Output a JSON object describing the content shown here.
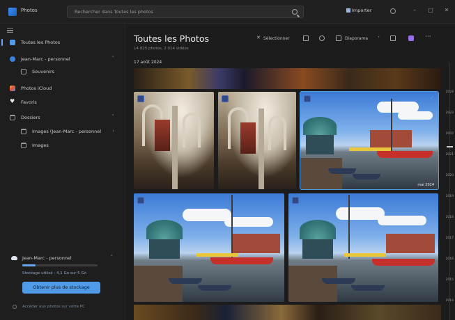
{
  "window": {
    "app_title": "Photos",
    "search_placeholder": "Rechercher dans Toutes les photos",
    "import_label": "Importer"
  },
  "sidebar": {
    "items": [
      {
        "label": "Toutes les Photos",
        "icon": "photos-icon",
        "active": true
      },
      {
        "label": "Jean-Marc - personnel",
        "icon": "onedrive-icon"
      },
      {
        "label": "Souvenirs",
        "icon": "memories-icon"
      },
      {
        "label": "Photos iCloud",
        "icon": "icloud-icon"
      },
      {
        "label": "Favoris",
        "icon": "heart-icon"
      },
      {
        "label": "Dossiers",
        "icon": "folder-icon"
      },
      {
        "label": "Images (Jean-Marc - personnel",
        "icon": "folder-icon"
      },
      {
        "label": "Images",
        "icon": "folder-icon"
      }
    ],
    "storage": {
      "title": "Jean-Marc - personnel",
      "usage_text": "Stockage utilisé : 4,1 Go sur 5 Go",
      "usage_fraction": 0.18,
      "button_label": "Obtenir plus de stockage",
      "note": "Accéder aux photos sur votre PC"
    }
  },
  "main": {
    "title": "Toutes les Photos",
    "subtitle": "14 825 photos, 2 014 vidéos",
    "date_header": "17 août 2024",
    "toolbar": {
      "select_label": "Sélectionner",
      "slideshow_label": "Diaporama"
    },
    "photos": [
      {
        "name": "photo-church-1",
        "type": "church",
        "label": ""
      },
      {
        "name": "photo-church-2",
        "type": "church",
        "label": ""
      },
      {
        "name": "photo-harbor-1",
        "type": "harbor",
        "label": "mai 2024",
        "favorite": true
      },
      {
        "name": "photo-harbor-2",
        "type": "harbor",
        "label": ""
      },
      {
        "name": "photo-harbor-3",
        "type": "harbor",
        "label": ""
      }
    ],
    "timeline_years": [
      "2024",
      "2023",
      "2022",
      "2021",
      "2020",
      "2019",
      "2018",
      "2017",
      "2016",
      "2015",
      "2014"
    ]
  }
}
